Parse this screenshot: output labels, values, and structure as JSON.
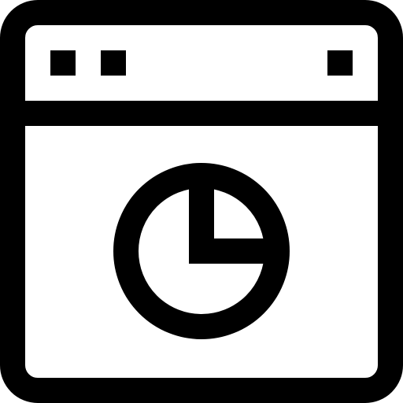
{
  "icon": {
    "name": "browser-window-pie-chart-icon",
    "stroke_color": "#000000",
    "background_color": "#ffffff",
    "window": {
      "left_buttons": [
        "window-control-square",
        "window-control-square"
      ],
      "right_buttons": [
        "window-control-square"
      ]
    },
    "content": {
      "symbol": "pie-chart-icon",
      "highlighted_slice_fraction": 0.25
    }
  }
}
